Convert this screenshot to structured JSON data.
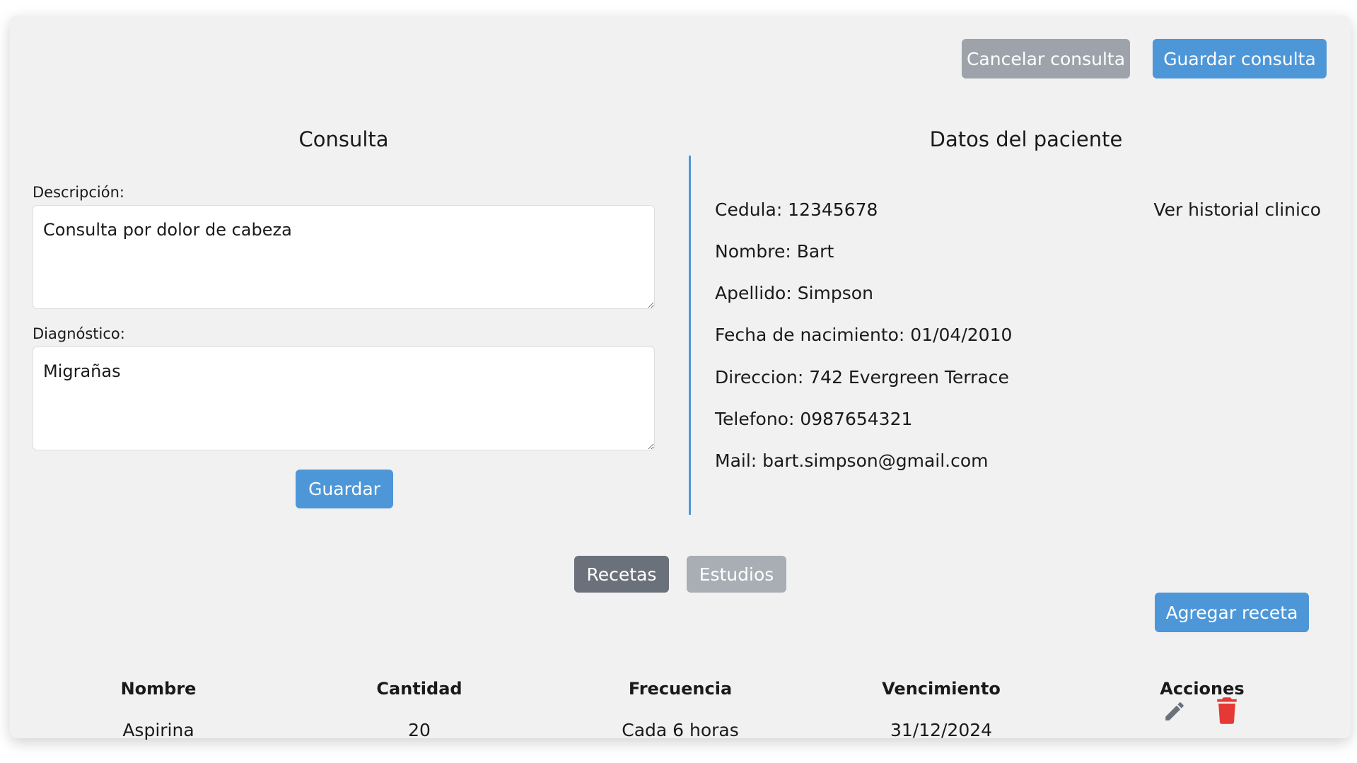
{
  "header": {
    "cancel_label": "Cancelar consulta",
    "save_label": "Guardar consulta"
  },
  "consulta": {
    "title": "Consulta",
    "descripcion_label": "Descripción:",
    "descripcion_value": "Consulta por dolor de cabeza",
    "diagnostico_label": "Diagnóstico:",
    "diagnostico_value": "Migrañas",
    "guardar_label": "Guardar"
  },
  "paciente": {
    "title": "Datos del paciente",
    "historial_link": "Ver historial clinico",
    "fields": [
      "Cedula: 12345678",
      "Nombre: Bart",
      "Apellido: Simpson",
      "Fecha de nacimiento: 01/04/2010",
      "Direccion: 742 Evergreen Terrace",
      "Telefono: 0987654321",
      "Mail: bart.simpson@gmail.com"
    ]
  },
  "tabs": {
    "recetas": "Recetas",
    "estudios": "Estudios",
    "active": "Recetas"
  },
  "recetas": {
    "add_label": "Agregar receta",
    "columns": [
      "Nombre",
      "Cantidad",
      "Frecuencia",
      "Vencimiento",
      "Acciones"
    ],
    "rows": [
      {
        "nombre": "Aspirina",
        "cantidad": "20",
        "frecuencia": "Cada 6 horas",
        "vencimiento": "31/12/2024"
      }
    ],
    "actions": [
      "pencil-icon",
      "trash-icon"
    ]
  },
  "colors": {
    "primary": "#4d97d8",
    "secondary": "#9ea3ab",
    "danger": "#e53935",
    "tab_active": "#6b717b",
    "background": "#f1f1f1"
  }
}
